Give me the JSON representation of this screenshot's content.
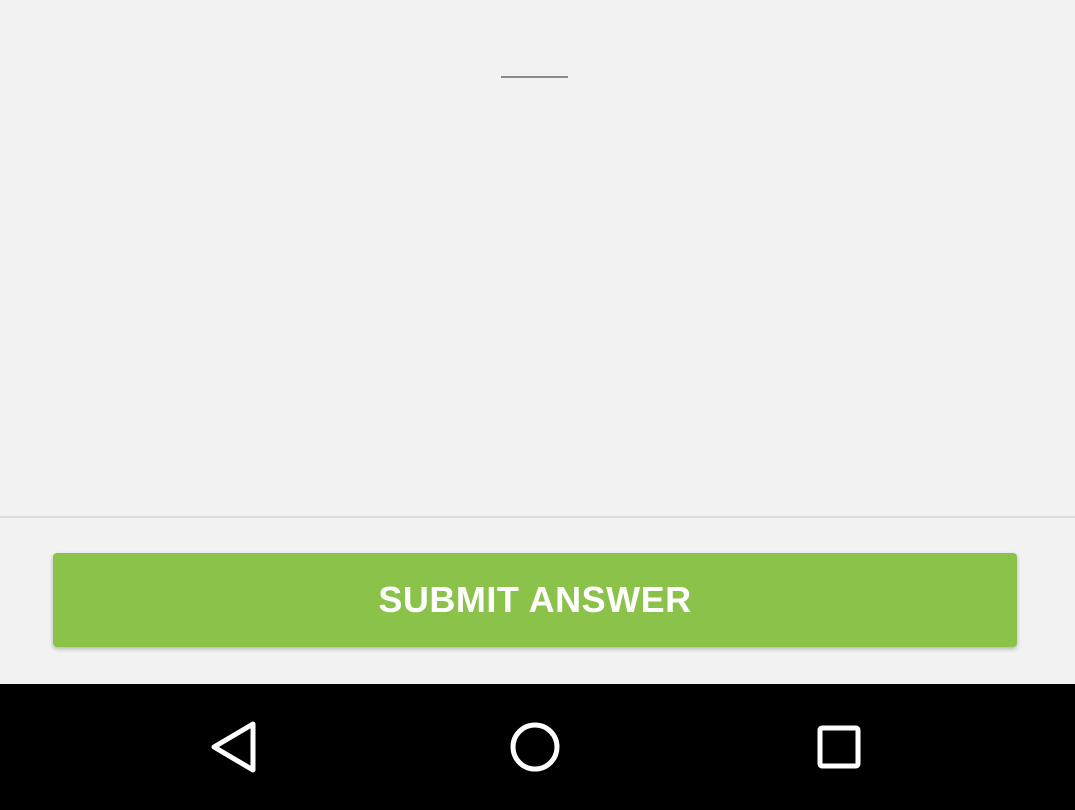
{
  "answer_input": {
    "value": "",
    "placeholder": ""
  },
  "submit_button": {
    "label": "SUBMIT ANSWER",
    "color": "#8bc34a"
  },
  "navigation_bar": {
    "background": "#000000",
    "icons": [
      "back-icon",
      "home-icon",
      "recents-icon"
    ]
  }
}
